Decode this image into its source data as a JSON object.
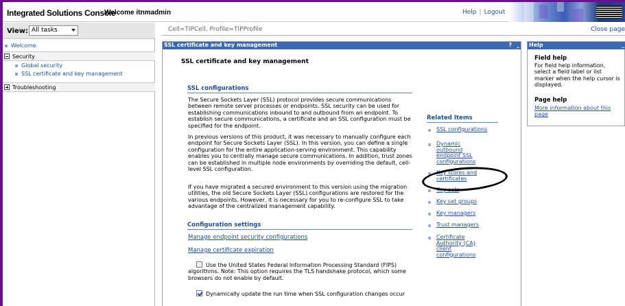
{
  "app": {
    "title": "Integrated Solutions Console",
    "welcome": "Welcome itnmadmin"
  },
  "toplinks": {
    "help": "Help",
    "separator": "|",
    "logout": "Logout"
  },
  "leftnav": {
    "view_label": "View:",
    "view_value": "All tasks",
    "welcome": "Welcome",
    "security_section": "Security",
    "security_items": [
      "Global security",
      "SSL certificate and key management"
    ],
    "troubleshooting_section": "Troubleshooting"
  },
  "main": {
    "breadcrumb": "Cell=TIPCell, Profile=TIPProfile",
    "close_page": "Close page"
  },
  "panel": {
    "header_title": "SSL certificate and key management",
    "header_help": "?",
    "header_min": "_",
    "heading": "SSL certificate and key management",
    "ssl_configurations_heading": "SSL configurations",
    "paragraphs": [
      "The Secure Sockets Layer (SSL) protocol provides secure communications between remote server processes or endpoints. SSL security can be used for establishing communications inbound to and outbound from an endpoint. To establish secure communications, a certificate and an SSL configuration must be specified for the endpoint.",
      "In previous versions of this product, it was necessary to manually configure each endpoint for Secure Sockets Layer (SSL). In this version, you can define a single configuration for the entire application-serving environment. This capability enables you to centrally manage secure communications. In addition, trust zones can be established in multiple node environments by overriding the default, cell-level SSL configuration.",
      "If you have migrated a secured environment to this version using the migration utilities, the old Secure Sockets Layer (SSL) configurations are restored for the various endpoints. However, it is necessary for you to re-configure SSL to take advantage of the centralized management capability."
    ],
    "configuration_settings_heading": "Configuration settings",
    "settings_links": [
      "Manage endpoint security configurations",
      "Manage certificate expiration"
    ],
    "fips_label": "Use the United States Federal Information Processing Standard (FIPS) algorithms. Note: This option requires the TLS handshake protocol, which some browsers do not enable by default.",
    "fips_checked": false,
    "dynamic_label": "Dynamically update the run time when SSL configuration changes occur",
    "dynamic_checked": true,
    "related_heading": "Related Items",
    "related_items": [
      "SSL configurations",
      "Dynamic outbound endpoint SSL configurations",
      "Key stores and certificates",
      "Key sets",
      "Key set groups",
      "Key managers",
      "Trust managers",
      "Certificate Authority (CA) client configurations"
    ]
  },
  "help": {
    "header_title": "Help",
    "header_min": "_",
    "field_help_heading": "Field help",
    "field_help_text": "For field help information, select a field label or list marker when the help cursor is displayed.",
    "page_help_heading": "Page help",
    "page_help_link": "More information about this page"
  }
}
